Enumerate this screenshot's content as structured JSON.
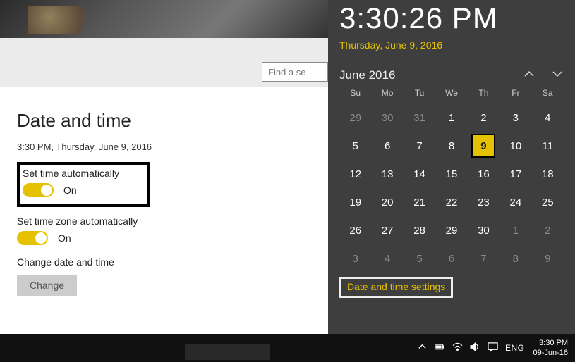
{
  "search": {
    "placeholder": "Find a se"
  },
  "settings": {
    "heading": "Date and time",
    "current": "3:30 PM, Thursday, June 9, 2016",
    "auto_time_label": "Set time automatically",
    "auto_time_state": "On",
    "auto_tz_label": "Set time zone automatically",
    "auto_tz_state": "On",
    "change_label": "Change date and time",
    "change_button": "Change"
  },
  "flyout": {
    "time": "3:30:26 PM",
    "date": "Thursday, June 9, 2016",
    "month": "June 2016",
    "weekdays": [
      "Su",
      "Mo",
      "Tu",
      "We",
      "Th",
      "Fr",
      "Sa"
    ],
    "grid": [
      {
        "n": "29",
        "dim": true
      },
      {
        "n": "30",
        "dim": true
      },
      {
        "n": "31",
        "dim": true
      },
      {
        "n": "1"
      },
      {
        "n": "2"
      },
      {
        "n": "3"
      },
      {
        "n": "4"
      },
      {
        "n": "5"
      },
      {
        "n": "6"
      },
      {
        "n": "7"
      },
      {
        "n": "8"
      },
      {
        "n": "9",
        "today": true
      },
      {
        "n": "10"
      },
      {
        "n": "11"
      },
      {
        "n": "12"
      },
      {
        "n": "13"
      },
      {
        "n": "14"
      },
      {
        "n": "15"
      },
      {
        "n": "16"
      },
      {
        "n": "17"
      },
      {
        "n": "18"
      },
      {
        "n": "19"
      },
      {
        "n": "20"
      },
      {
        "n": "21"
      },
      {
        "n": "22"
      },
      {
        "n": "23"
      },
      {
        "n": "24"
      },
      {
        "n": "25"
      },
      {
        "n": "26"
      },
      {
        "n": "27"
      },
      {
        "n": "28"
      },
      {
        "n": "29"
      },
      {
        "n": "30"
      },
      {
        "n": "1",
        "dim": true
      },
      {
        "n": "2",
        "dim": true
      },
      {
        "n": "3",
        "dim": true
      },
      {
        "n": "4",
        "dim": true
      },
      {
        "n": "5",
        "dim": true
      },
      {
        "n": "6",
        "dim": true
      },
      {
        "n": "7",
        "dim": true
      },
      {
        "n": "8",
        "dim": true
      },
      {
        "n": "9",
        "dim": true
      }
    ],
    "link": "Date and time settings"
  },
  "taskbar": {
    "lang": "ENG",
    "time": "3:30 PM",
    "date": "09-Jun-16"
  },
  "colors": {
    "accent": "#e6c100"
  }
}
